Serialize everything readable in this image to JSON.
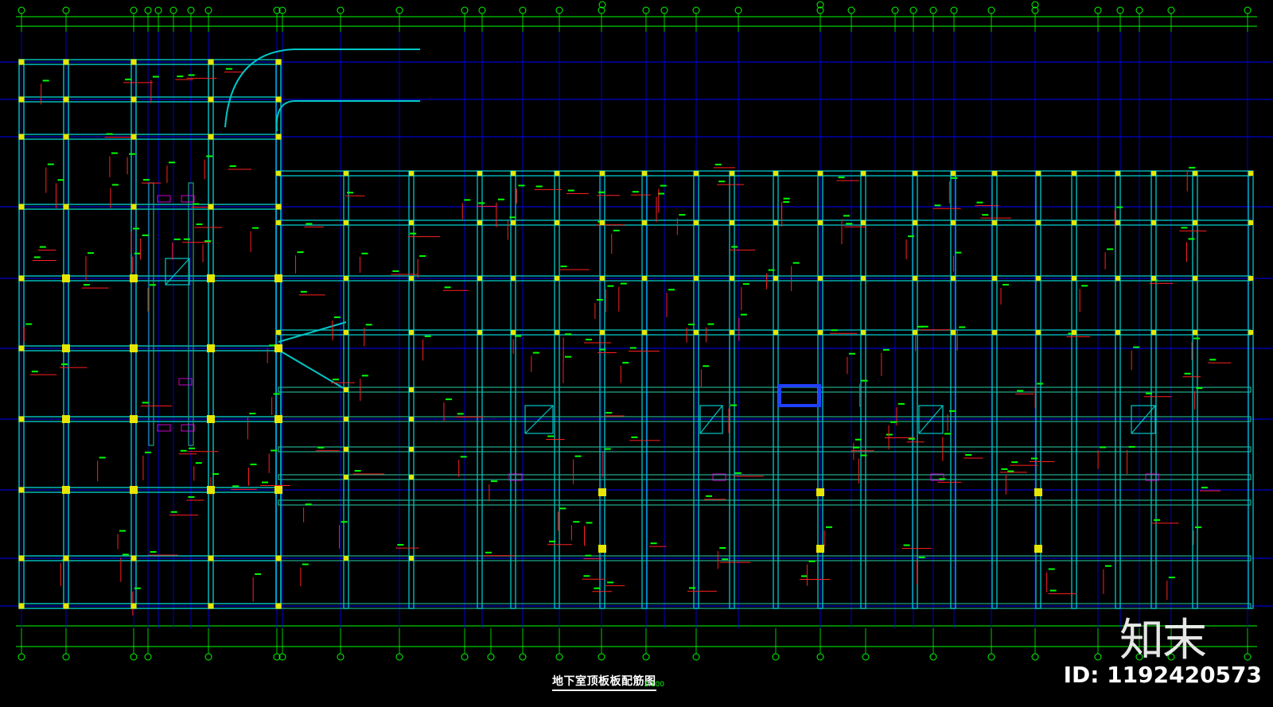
{
  "drawing": {
    "title": "地下室顶板板配筋图",
    "scale": "1:100",
    "colors": {
      "background": "#000000",
      "axis": "#00ff00",
      "grid": "#0000ff",
      "beam": "#00c8c8",
      "beam_alt": "#20a080",
      "column": "#e6e600",
      "rebar": "#ff2020",
      "tag": "#ff00ff"
    }
  },
  "watermark": {
    "logo": "知末",
    "id": "ID: 1192420573"
  }
}
